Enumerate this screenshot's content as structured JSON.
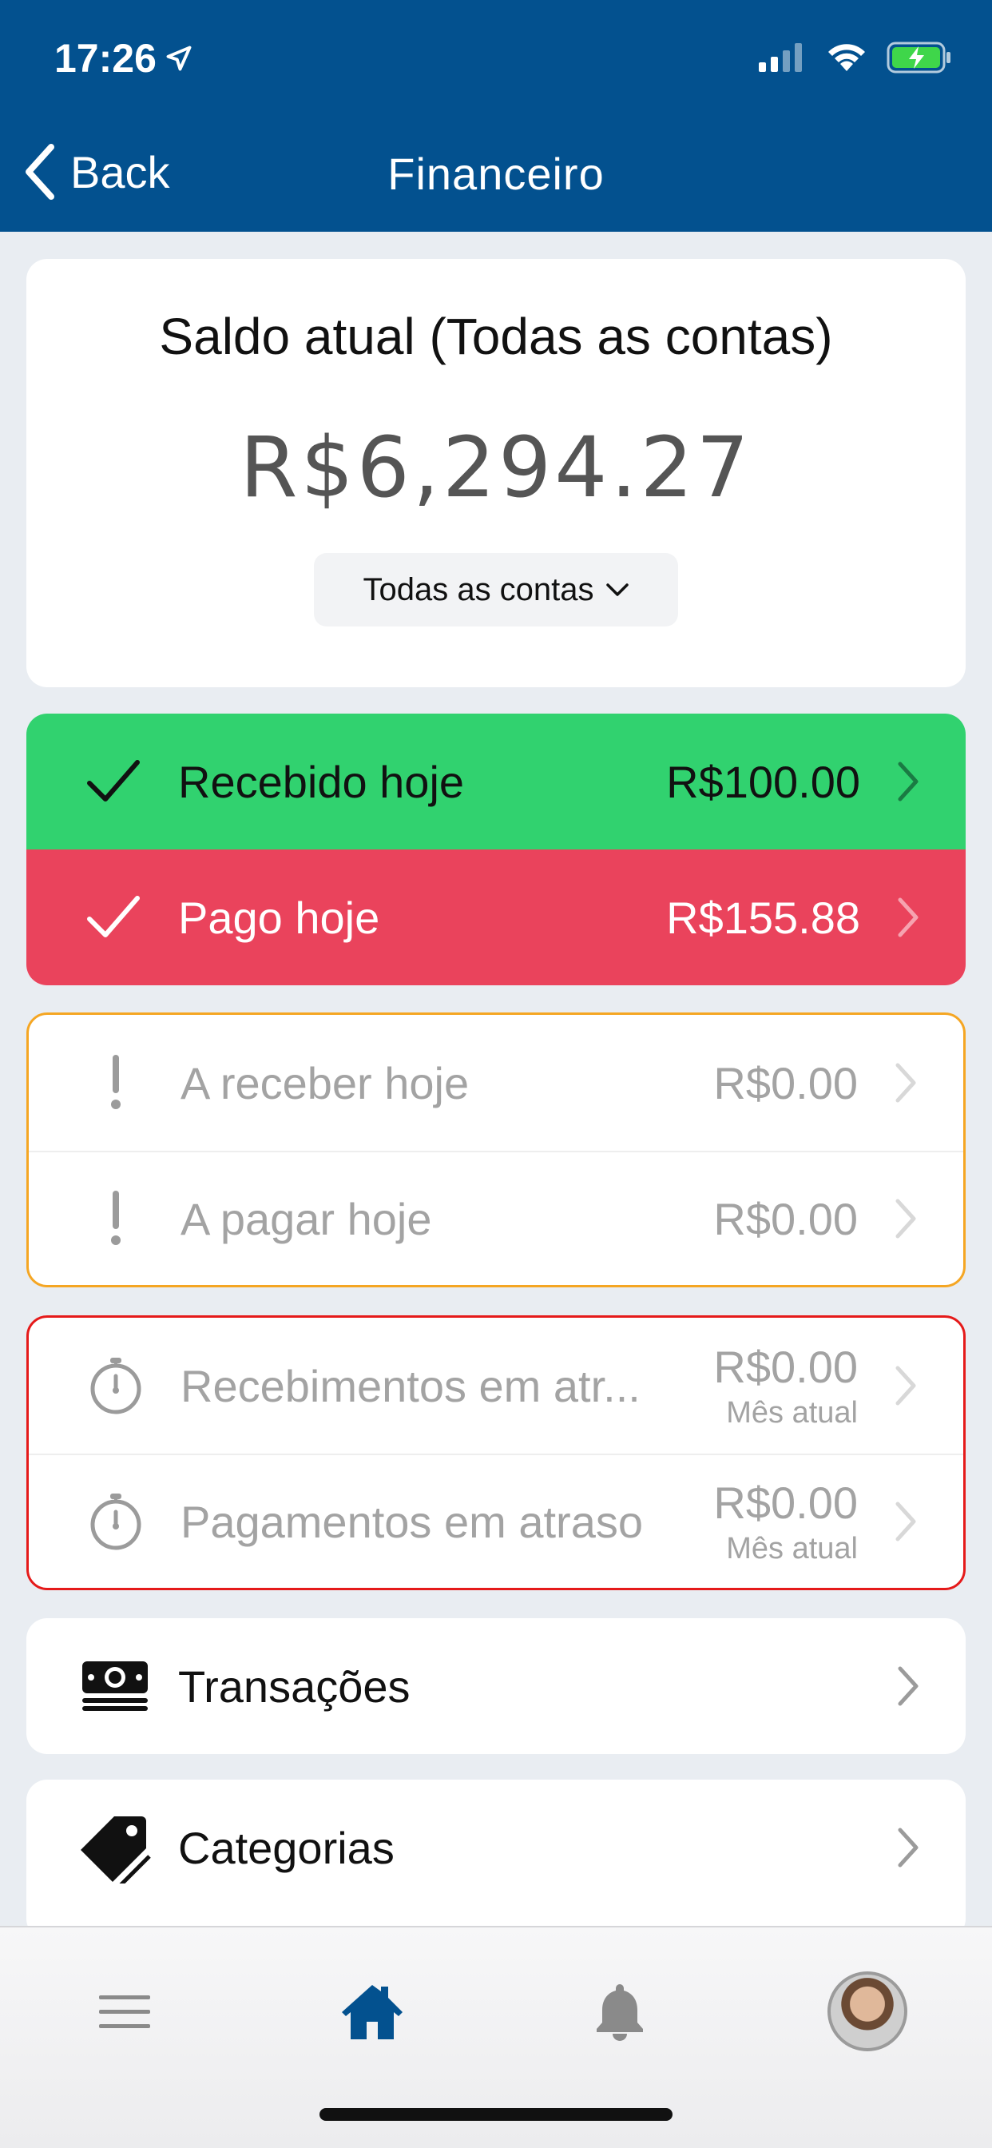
{
  "status_bar": {
    "time": "17:26"
  },
  "nav": {
    "back_label": "Back",
    "title": "Financeiro"
  },
  "balance": {
    "title": "Saldo atual (Todas as contas)",
    "amount": "R$6,294.27",
    "account_selector": "Todas as contas"
  },
  "today": {
    "received": {
      "label": "Recebido hoje",
      "value": "R$100.00",
      "color": "#31d26f"
    },
    "paid": {
      "label": "Pago hoje",
      "value": "R$155.88",
      "color": "#ea435c"
    }
  },
  "pending": {
    "to_receive": {
      "label": "A receber hoje",
      "value": "R$0.00"
    },
    "to_pay": {
      "label": "A pagar hoje",
      "value": "R$0.00"
    }
  },
  "late": {
    "receipts": {
      "label": "Recebimentos em atr...",
      "value": "R$0.00",
      "period": "Mês atual"
    },
    "payments": {
      "label": "Pagamentos em atraso",
      "value": "R$0.00",
      "period": "Mês atual"
    }
  },
  "menu": {
    "transactions": {
      "label": "Transações",
      "icon": "money-icon"
    },
    "categories": {
      "label": "Categorias",
      "icon": "tag-icon"
    }
  },
  "tabbar": {
    "items": [
      {
        "name": "menu",
        "icon": "hamburger-icon"
      },
      {
        "name": "home",
        "icon": "home-icon",
        "active": true
      },
      {
        "name": "notifications",
        "icon": "bell-icon"
      },
      {
        "name": "profile",
        "icon": "avatar"
      }
    ],
    "active_color": "#03518f"
  },
  "colors": {
    "header": "#03518f",
    "pending_border": "#f5a623",
    "late_border": "#e51a1a"
  }
}
